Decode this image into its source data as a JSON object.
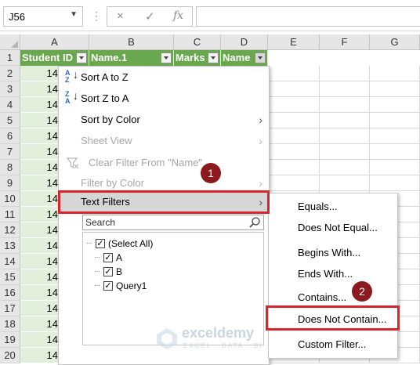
{
  "name_box": {
    "value": "J56"
  },
  "formula_bar": {
    "cancel_icon": "×",
    "enter_icon": "✓",
    "fx_label": "fx",
    "value": ""
  },
  "columns": [
    "A",
    "B",
    "C",
    "D",
    "E",
    "F",
    "G"
  ],
  "rows": [
    "1",
    "2",
    "3",
    "4",
    "5",
    "6",
    "7",
    "8",
    "9",
    "10",
    "11",
    "12",
    "13",
    "14",
    "15",
    "16",
    "17",
    "18",
    "19",
    "20"
  ],
  "header_row": [
    "Student ID",
    "Name.1",
    "Marks",
    "Name"
  ],
  "visible_ids": [
    "14",
    "14",
    "14",
    "14",
    "14",
    "14",
    "14",
    "14",
    "14",
    "14",
    "14",
    "14",
    "14",
    "14",
    "14",
    "14",
    "14",
    "14",
    "14"
  ],
  "filter_menu": {
    "items": [
      {
        "label": "Sort A to Z",
        "icon": "sort-a-to-z-icon",
        "enabled": true
      },
      {
        "label": "Sort Z to A",
        "icon": "sort-z-to-a-icon",
        "enabled": true
      },
      {
        "label": "Sort by Color",
        "submenu": true,
        "enabled": true
      },
      {
        "label": "Sheet View",
        "submenu": true,
        "enabled": false
      },
      {
        "label": "Clear Filter From \"Name\"",
        "icon": "clear-filter-icon",
        "enabled": false
      },
      {
        "label": "Filter by Color",
        "submenu": true,
        "enabled": false
      },
      {
        "label": "Text Filters",
        "submenu": true,
        "enabled": true,
        "highlighted": true
      }
    ],
    "search_placeholder": "Search",
    "checklist": [
      {
        "label": "(Select All)",
        "checked": true
      },
      {
        "label": "A",
        "checked": true
      },
      {
        "label": "B",
        "checked": true
      },
      {
        "label": "Query1",
        "checked": true
      }
    ]
  },
  "text_filters_submenu": {
    "items": [
      "Equals...",
      "Does Not Equal...",
      "Begins With...",
      "Ends With...",
      "Contains...",
      "Does Not Contain...",
      "Custom Filter..."
    ]
  },
  "step_badges": [
    "1",
    "2"
  ],
  "colors": {
    "header_green": "#6aa84f",
    "id_fill": "#e2efda",
    "highlight_red": "#d9232d",
    "badge": "#8b1a1e"
  }
}
